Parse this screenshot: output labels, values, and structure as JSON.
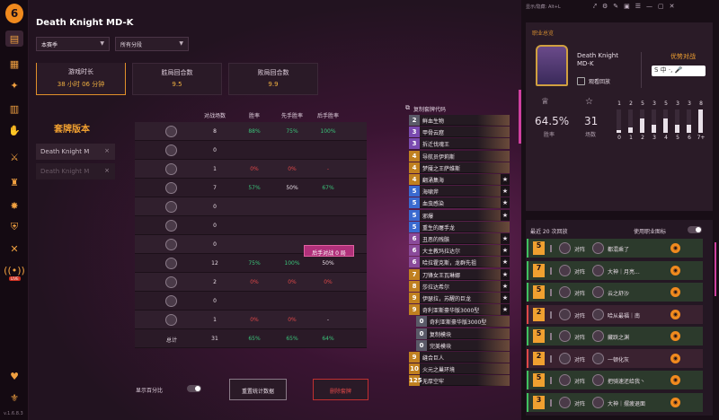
{
  "app": {
    "version": "v.1.6.8.3"
  },
  "header": {
    "title": "Death Knight MD-K",
    "season_select": "本赛季",
    "rank_select": "所有分段"
  },
  "stats": {
    "duration_label": "游戏时长",
    "duration_value": "38 小时 06 分钟",
    "win_turns_label": "胜局回合数",
    "win_turns_value": "9.5",
    "loss_turns_label": "败局回合数",
    "loss_turns_value": "9.9"
  },
  "deck_versions": {
    "title": "套牌版本",
    "items": [
      {
        "label": "Death Knight M"
      },
      {
        "label": "Death Knight M"
      }
    ]
  },
  "table": {
    "headers": [
      "对战场数",
      "胜率",
      "先手胜率",
      "后手胜率"
    ],
    "rows": [
      {
        "games": "8",
        "winrate": "88%",
        "first": "75%",
        "second": "100%",
        "c1": "g",
        "c2": "g",
        "c3": "g"
      },
      {
        "games": "0",
        "winrate": "",
        "first": "",
        "second": "",
        "c1": "w",
        "c2": "w",
        "c3": "w"
      },
      {
        "games": "1",
        "winrate": "0%",
        "first": "0%",
        "second": "-",
        "c1": "r",
        "c2": "r",
        "c3": "r"
      },
      {
        "games": "7",
        "winrate": "57%",
        "first": "50%",
        "second": "67%",
        "c1": "g",
        "c2": "w",
        "c3": "g"
      },
      {
        "games": "0",
        "winrate": "",
        "first": "",
        "second": "",
        "c1": "w",
        "c2": "w",
        "c3": "w"
      },
      {
        "games": "0",
        "winrate": "",
        "first": "",
        "second": "",
        "c1": "w",
        "c2": "w",
        "c3": "w"
      },
      {
        "games": "0",
        "winrate": "",
        "first": "",
        "second": "",
        "c1": "w",
        "c2": "w",
        "c3": "w"
      },
      {
        "games": "12",
        "winrate": "75%",
        "first": "100%",
        "second": "50%",
        "c1": "g",
        "c2": "g",
        "c3": "w"
      },
      {
        "games": "2",
        "winrate": "0%",
        "first": "0%",
        "second": "0%",
        "c1": "r",
        "c2": "r",
        "c3": "r"
      },
      {
        "games": "0",
        "winrate": "",
        "first": "",
        "second": "",
        "c1": "w",
        "c2": "w",
        "c3": "w"
      },
      {
        "games": "1",
        "winrate": "0%",
        "first": "0%",
        "second": "-",
        "c1": "r",
        "c2": "r",
        "c3": "w"
      }
    ],
    "total_label": "总计",
    "total": {
      "games": "31",
      "winrate": "65%",
      "first": "65%",
      "second": "64%"
    },
    "mirror_button": "后手对战 0 局"
  },
  "controls": {
    "show_percent_label": "显示百分比",
    "reset_button": "重置统计数据",
    "delete_button": "删除套牌"
  },
  "decklist": {
    "copy_label": "复制套牌代码",
    "cards": [
      {
        "cost": "2",
        "name": "鲜血生物"
      },
      {
        "cost": "3",
        "name": "甲骨云窟"
      },
      {
        "cost": "3",
        "name": "拆迁伐魂王"
      },
      {
        "cost": "4",
        "name": "导航员伊莉斯"
      },
      {
        "cost": "4",
        "name": "梦魇之王萨维斯"
      },
      {
        "cost": "4",
        "name": "翻涌集海"
      },
      {
        "cost": "5",
        "name": "海啸斧"
      },
      {
        "cost": "5",
        "name": "血虫感染"
      },
      {
        "cost": "5",
        "name": "邪爆"
      },
      {
        "cost": "5",
        "name": "重生的屠手龙"
      },
      {
        "cost": "6",
        "name": "丑恶的残骸"
      },
      {
        "cost": "6",
        "name": "大主教玛拉达尔"
      },
      {
        "cost": "6",
        "name": "哈拉霍克斯，龙群先祖"
      },
      {
        "cost": "7",
        "name": "刀锋女王瓦琳娜"
      },
      {
        "cost": "8",
        "name": "莎拉达希尔"
      },
      {
        "cost": "9",
        "name": "伊瑟拉，苏醒的巨龙"
      },
      {
        "cost": "9",
        "name": "奇利亚斯豪华版3000型"
      },
      {
        "cost": "0",
        "name": "奇利亚斯豪华版3000型"
      },
      {
        "cost": "0",
        "name": "复制模块"
      },
      {
        "cost": "0",
        "name": "完美模块"
      },
      {
        "cost": "9",
        "name": "缝合巨人"
      },
      {
        "cost": "10",
        "name": "火元之巢环境"
      },
      {
        "cost": "125",
        "name": "无厚空牢"
      }
    ]
  },
  "right_panel": {
    "topbar_label": "显示/隐藏: Alt+L",
    "panel_title": "职业总览",
    "hero_name": "Death Knight MD-K",
    "replay_label": "观看回放",
    "advantage_title": "优势对战",
    "winrate": "64.5%",
    "winrate_label": "胜率",
    "games": "31",
    "games_label": "场数",
    "curve": {
      "labels": [
        "0",
        "1",
        "2",
        "3",
        "4",
        "5",
        "6",
        "7+"
      ],
      "counts": [
        "1",
        "2",
        "5",
        "3",
        "5",
        "3",
        "3",
        "8"
      ],
      "fill": [
        0.1,
        0.25,
        0.6,
        0.35,
        0.6,
        0.35,
        0.35,
        1.0
      ]
    },
    "recent_title": "最近 20 次回放",
    "recent_option": "使用职业图标",
    "games_list": [
      {
        "turn": "5",
        "result": "win",
        "vs": "对阵",
        "opp": "都混乘了"
      },
      {
        "turn": "7",
        "result": "win",
        "vs": "对阵",
        "opp": "大神｜月亮..."
      },
      {
        "turn": "5",
        "result": "win",
        "vs": "对阵",
        "opp": "云之舒沙"
      },
      {
        "turn": "2",
        "result": "loss",
        "vs": "对阵",
        "opp": "哈从最福｜南"
      },
      {
        "turn": "5",
        "result": "win",
        "vs": "对阵",
        "opp": "藏跃之渊"
      },
      {
        "turn": "2",
        "result": "loss",
        "vs": "对阵",
        "opp": "一顿化灰"
      },
      {
        "turn": "5",
        "result": "win",
        "vs": "对阵",
        "opp": "把骑速还给我丶"
      },
      {
        "turn": "3",
        "result": "win",
        "vs": "对阵",
        "opp": "大神｜摆疲退面"
      }
    ]
  },
  "colors": {
    "accent": "#f0a030",
    "win": "#40c060",
    "loss": "#e04848",
    "mana": "#3a6ad0"
  }
}
